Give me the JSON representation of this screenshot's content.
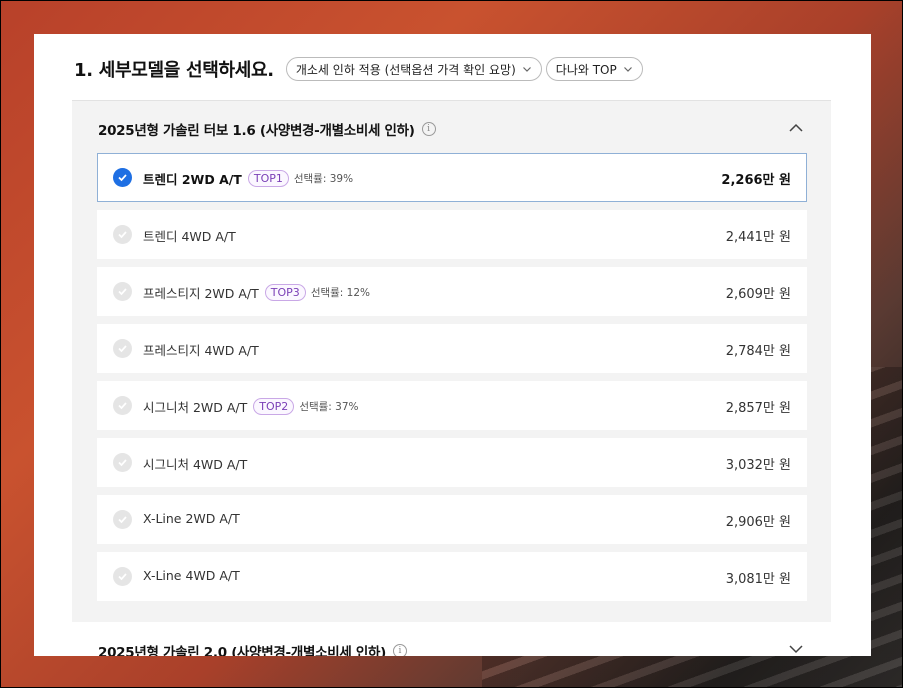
{
  "header": {
    "title": "1. 세부모델을 선택하세요.",
    "filter_tax": "개소세 인하 적용 (선택옵션 가격 확인 요망)",
    "filter_sort": "다나와 TOP"
  },
  "group1": {
    "title": "2025년형 가솔린 터보 1.6 (사양변경-개별소비세 인하)",
    "info": "i",
    "expanded": true,
    "items": [
      {
        "name": "트렌디 2WD A/T",
        "badge": "TOP1",
        "rate": "선택률: 39%",
        "price": "2,266만 원",
        "selected": true
      },
      {
        "name": "트렌디 4WD A/T",
        "badge": "",
        "rate": "",
        "price": "2,441만 원",
        "selected": false
      },
      {
        "name": "프레스티지 2WD A/T",
        "badge": "TOP3",
        "rate": "선택률: 12%",
        "price": "2,609만 원",
        "selected": false
      },
      {
        "name": "프레스티지 4WD A/T",
        "badge": "",
        "rate": "",
        "price": "2,784만 원",
        "selected": false
      },
      {
        "name": "시그니처 2WD A/T",
        "badge": "TOP2",
        "rate": "선택률: 37%",
        "price": "2,857만 원",
        "selected": false
      },
      {
        "name": "시그니처 4WD A/T",
        "badge": "",
        "rate": "",
        "price": "3,032만 원",
        "selected": false
      },
      {
        "name": "X-Line 2WD A/T",
        "badge": "",
        "rate": "",
        "price": "2,906만 원",
        "selected": false
      },
      {
        "name": "X-Line 4WD A/T",
        "badge": "",
        "rate": "",
        "price": "3,081만 원",
        "selected": false
      }
    ]
  },
  "group2": {
    "title": "2025년형 가솔린 2.0 (사양변경-개별소비세 인하)",
    "info": "i",
    "expanded": false
  },
  "colors": {
    "selected_check": "#1e6fe3",
    "badge_text": "#7a3fb6",
    "selected_border": "#8fb0d6"
  }
}
